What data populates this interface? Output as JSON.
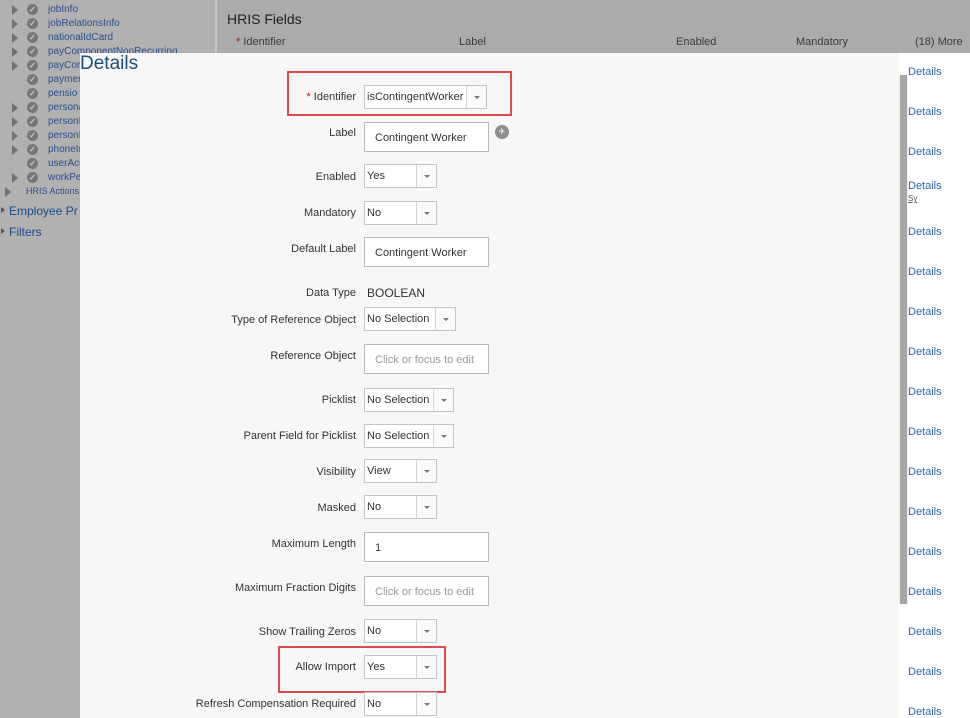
{
  "sidebar": {
    "tree_items": [
      {
        "label": "jobInfo"
      },
      {
        "label": "jobRelationsInfo"
      },
      {
        "label": "nationalIdCard"
      },
      {
        "label": "payComponentNonRecurring"
      },
      {
        "label": "payCor"
      },
      {
        "label": "paymen"
      },
      {
        "label": "pensio"
      },
      {
        "label": "persona"
      },
      {
        "label": "personI"
      },
      {
        "label": "personI"
      },
      {
        "label": "phoneIr"
      },
      {
        "label": "userAcc"
      },
      {
        "label": "workPe"
      }
    ],
    "hris_actions": "HRIS Actions",
    "employee_profile": "Employee Pr",
    "filters": "Filters"
  },
  "background": {
    "title": "HRIS Fields",
    "columns": {
      "identifier": "Identifier",
      "label": "Label",
      "enabled": "Enabled",
      "mandatory": "Mandatory",
      "more": "(18) More"
    },
    "required_mark": "*",
    "details_link": "Details",
    "details_count": 17,
    "sy_text": "Sy"
  },
  "modal": {
    "title": "Details",
    "required_mark": "*",
    "fields": {
      "identifier": {
        "label": "Identifier",
        "value": "isContingentWorker"
      },
      "label": {
        "label": "Label",
        "value": "Contingent Worker"
      },
      "enabled": {
        "label": "Enabled",
        "value": "Yes"
      },
      "mandatory": {
        "label": "Mandatory",
        "value": "No"
      },
      "default_label": {
        "label": "Default Label",
        "value": "Contingent Worker"
      },
      "data_type": {
        "label": "Data Type",
        "value": "BOOLEAN"
      },
      "type_of_reference_object": {
        "label": "Type of Reference Object",
        "value": "No Selection"
      },
      "reference_object": {
        "label": "Reference Object",
        "placeholder": "Click or focus to edit"
      },
      "picklist": {
        "label": "Picklist",
        "value": "No Selection"
      },
      "parent_field_for_picklist": {
        "label": "Parent Field for Picklist",
        "value": "No Selection"
      },
      "visibility": {
        "label": "Visibility",
        "value": "View"
      },
      "masked": {
        "label": "Masked",
        "value": "No"
      },
      "maximum_length": {
        "label": "Maximum Length",
        "value": "1"
      },
      "maximum_fraction_digits": {
        "label": "Maximum Fraction Digits",
        "placeholder": "Click or focus to edit"
      },
      "show_trailing_zeros": {
        "label": "Show Trailing Zeros",
        "value": "No"
      },
      "allow_import": {
        "label": "Allow Import",
        "value": "Yes"
      },
      "refresh_compensation_required": {
        "label": "Refresh Compensation Required",
        "value": "No"
      }
    }
  },
  "colors": {
    "highlight": "#e04a4a",
    "link": "#2a67b1",
    "title": "#1f4e79"
  },
  "icons": {
    "tree_check": "check-circle-icon",
    "tree_expand": "expand-triangle-icon",
    "label_translate": "globe-icon",
    "dropdown": "chevron-down-icon"
  }
}
